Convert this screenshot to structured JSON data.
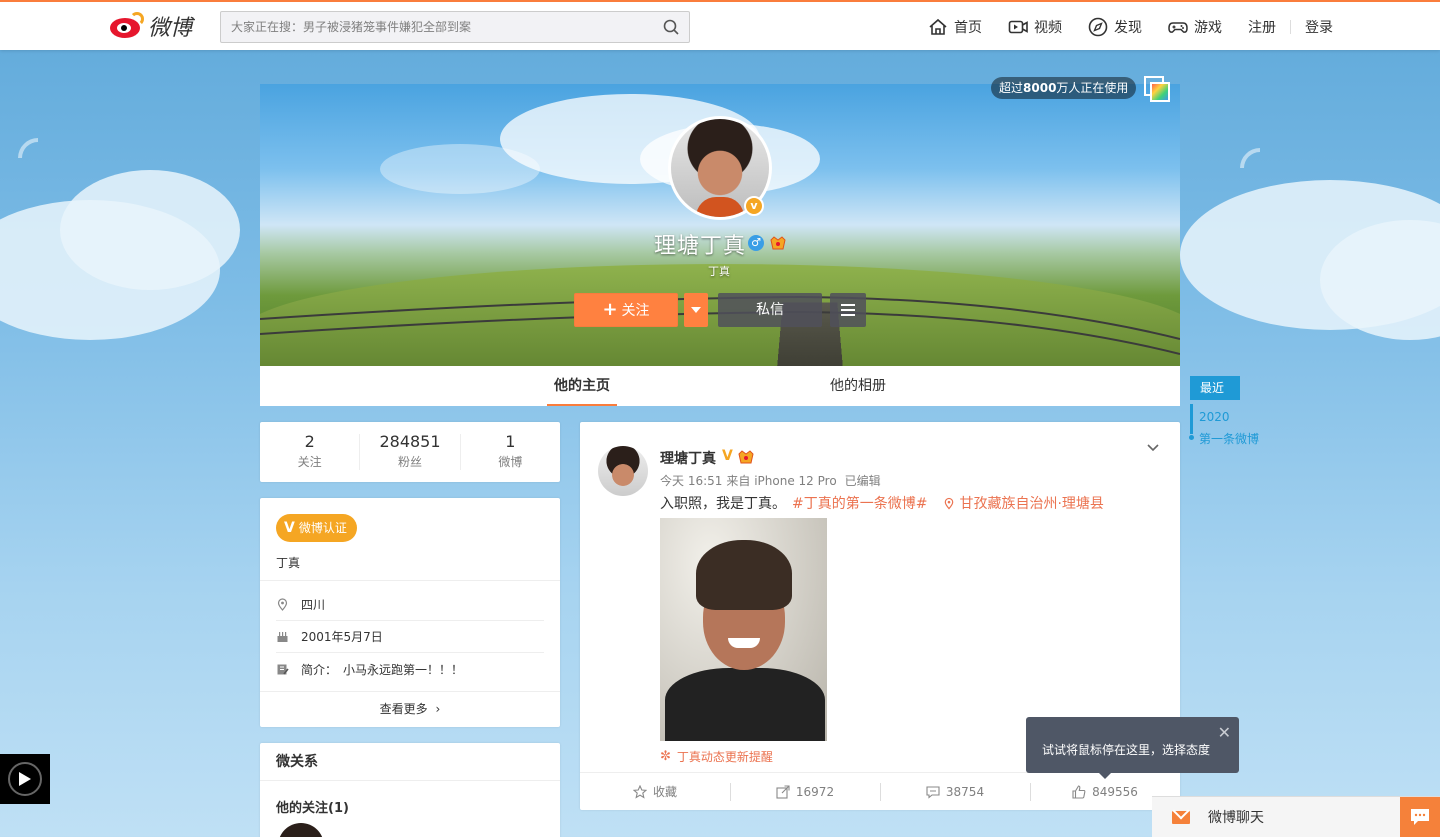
{
  "header": {
    "logo_text": "微博",
    "search_placeholder": "大家正在搜：男子被浸猪笼事件嫌犯全部到案",
    "nav": [
      "首页",
      "视频",
      "发现",
      "游戏"
    ],
    "register": "注册",
    "login": "登录"
  },
  "cover": {
    "users_badge_prefix": "超过",
    "users_badge_num": "8000",
    "users_badge_suffix": "万人正在使用",
    "name": "理塘丁真",
    "subtitle": "丁真",
    "v_mark": "v",
    "follow_label": "关注",
    "message_label": "私信"
  },
  "tabs": [
    "他的主页",
    "他的相册"
  ],
  "timeline": {
    "recent": "最近",
    "year": "2020",
    "first_post": "第一条微博"
  },
  "stats": [
    {
      "value": "2",
      "label": "关注"
    },
    {
      "value": "284851",
      "label": "粉丝"
    },
    {
      "value": "1",
      "label": "微博"
    }
  ],
  "info": {
    "verify_label": "微博认证",
    "verify_desc": "丁真",
    "location": "四川",
    "birthday": "2001年5月7日",
    "bio_label": "简介：",
    "bio": "小马永远跑第一！！！",
    "more": "查看更多"
  },
  "relation": {
    "title": "微关系",
    "following": "他的关注(1)"
  },
  "post": {
    "name": "理塘丁真",
    "v_mark": "V",
    "time": "今天 16:51",
    "source": "来自 iPhone 12 Pro",
    "edited": "已编辑",
    "text": "入职照，我是丁真。",
    "hashtag": "#丁真的第一条微博#",
    "location": "甘孜藏族自治州·理塘县",
    "remind": "丁真动态更新提醒",
    "actions": [
      {
        "label": "收藏",
        "icon": "star-icon"
      },
      {
        "label": "16972",
        "icon": "share-icon"
      },
      {
        "label": "38754",
        "icon": "comment-icon"
      },
      {
        "label": "849556",
        "icon": "like-icon"
      }
    ]
  },
  "tooltip": {
    "text": "试试将鼠标停在这里，选择态度",
    "close": "✕"
  },
  "chat": {
    "label": "微博聊天"
  },
  "colors": {
    "accent": "#fa7d3c",
    "link": "#eb7350",
    "blue": "#1f9ad6"
  }
}
